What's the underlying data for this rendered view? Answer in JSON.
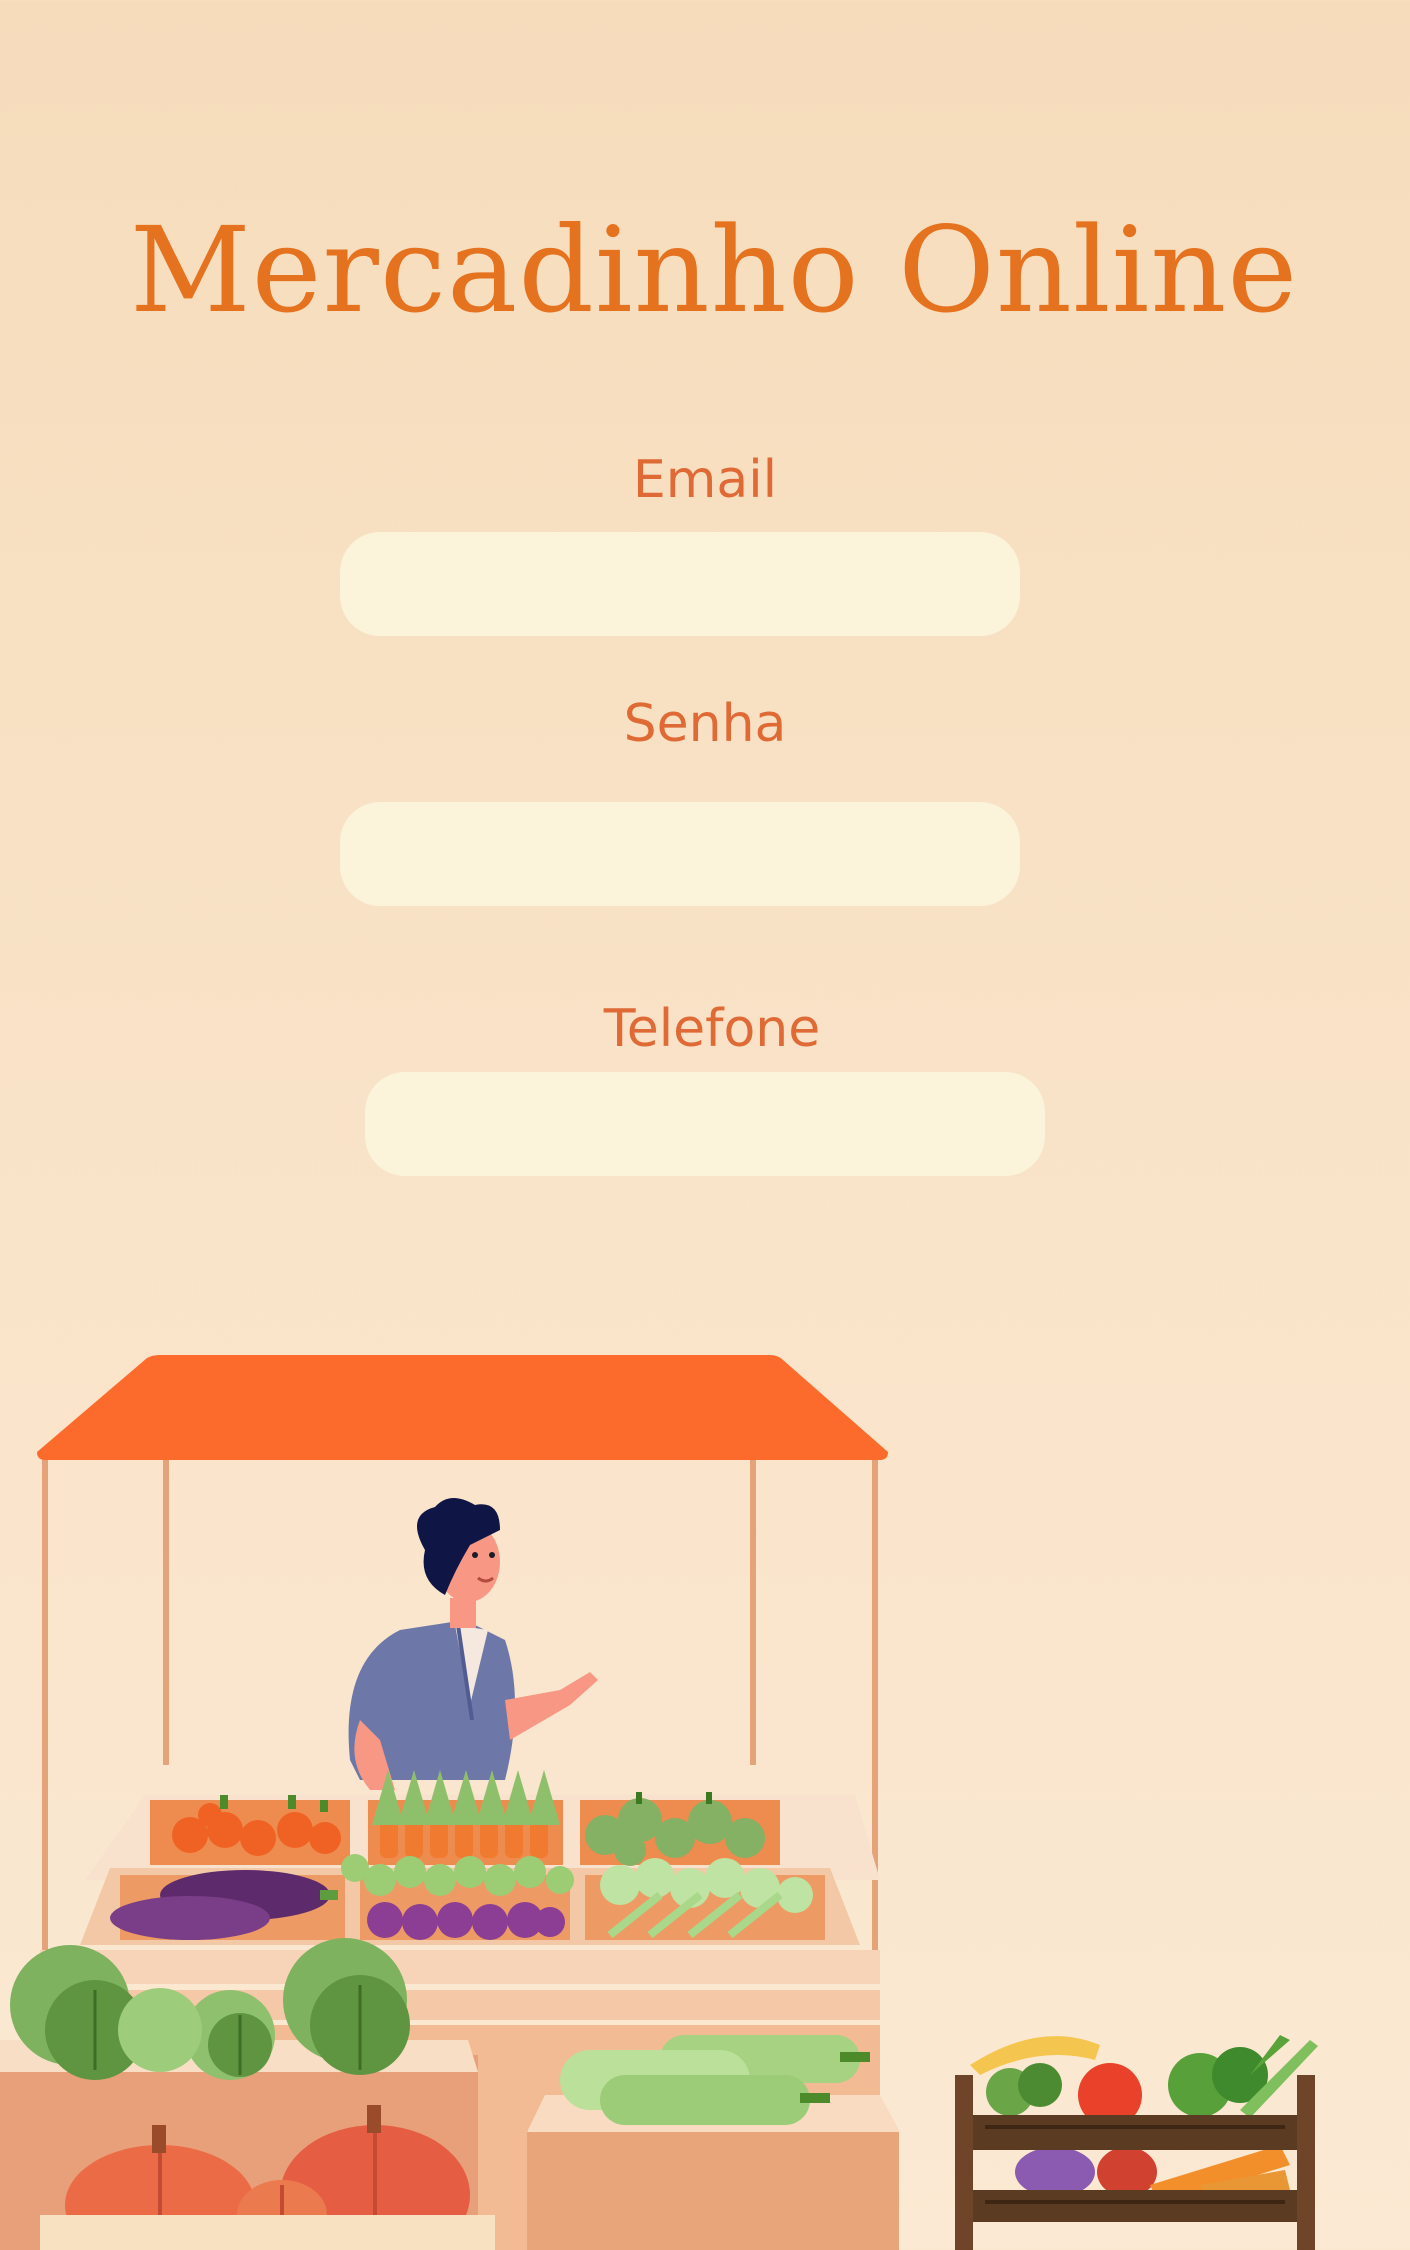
{
  "page": {
    "title": "Mercadinho Online"
  },
  "form": {
    "email_label": "Email",
    "email_value": "",
    "password_label": "Senha",
    "password_value": "",
    "phone_label": "Telefone",
    "phone_value": ""
  },
  "colors": {
    "background_top": "#f6dcbb",
    "title": "#e4721f",
    "label": "#df6a35",
    "field": "#fbf4da",
    "awning": "#fd6b2c"
  },
  "illustration": {
    "subject": "market-stall-illustration"
  }
}
